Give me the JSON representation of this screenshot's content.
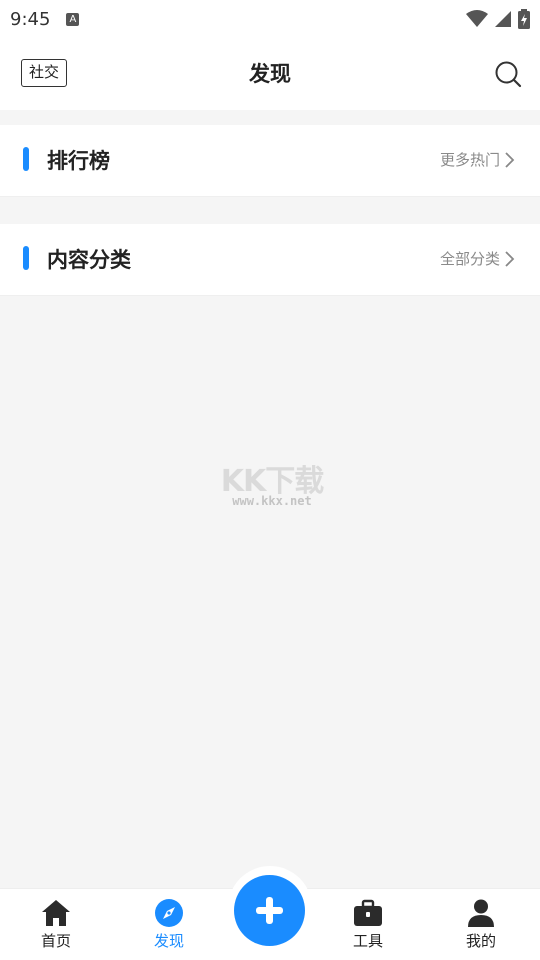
{
  "status_bar": {
    "time": "9:45",
    "notification_icon": "A"
  },
  "header": {
    "social_label": "社交",
    "title": "发现"
  },
  "sections": [
    {
      "title": "排行榜",
      "more_label": "更多热门"
    },
    {
      "title": "内容分类",
      "more_label": "全部分类"
    }
  ],
  "watermark": {
    "text": "KK下载",
    "url": "www.kkx.net"
  },
  "bottom_nav": [
    {
      "label": "首页",
      "icon": "home-icon",
      "active": false
    },
    {
      "label": "发现",
      "icon": "compass-icon",
      "active": true
    },
    {
      "label": "",
      "icon": "plus-icon",
      "active": false
    },
    {
      "label": "工具",
      "icon": "toolbox-icon",
      "active": false
    },
    {
      "label": "我的",
      "icon": "person-icon",
      "active": false
    }
  ],
  "colors": {
    "accent": "#1a8cff",
    "background": "#f5f5f5",
    "text": "#222222",
    "muted": "#8a8a8a"
  }
}
